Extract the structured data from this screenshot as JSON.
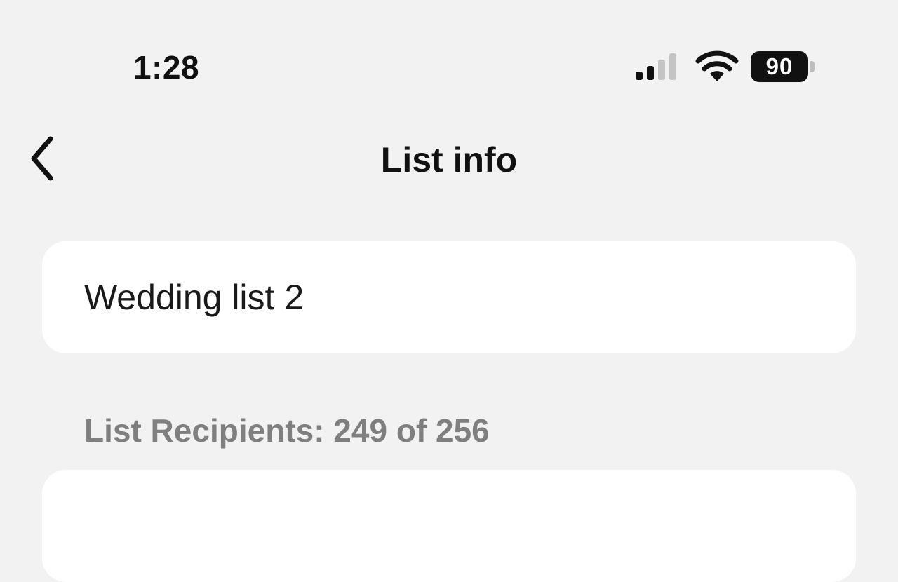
{
  "status_bar": {
    "time": "1:28",
    "battery_level": "90",
    "signal_bars_active": 2,
    "signal_bars_total": 4
  },
  "nav": {
    "title": "List info",
    "back_icon": "chevron-left-icon"
  },
  "list": {
    "name_value": "Wedding list 2",
    "recipients_label": "List Recipients: 249 of 256"
  },
  "colors": {
    "background": "#f2f2f2",
    "card": "#ffffff",
    "text_primary": "#111111",
    "text_secondary": "#7f7f7f",
    "signal_inactive": "#c4c4c4"
  }
}
